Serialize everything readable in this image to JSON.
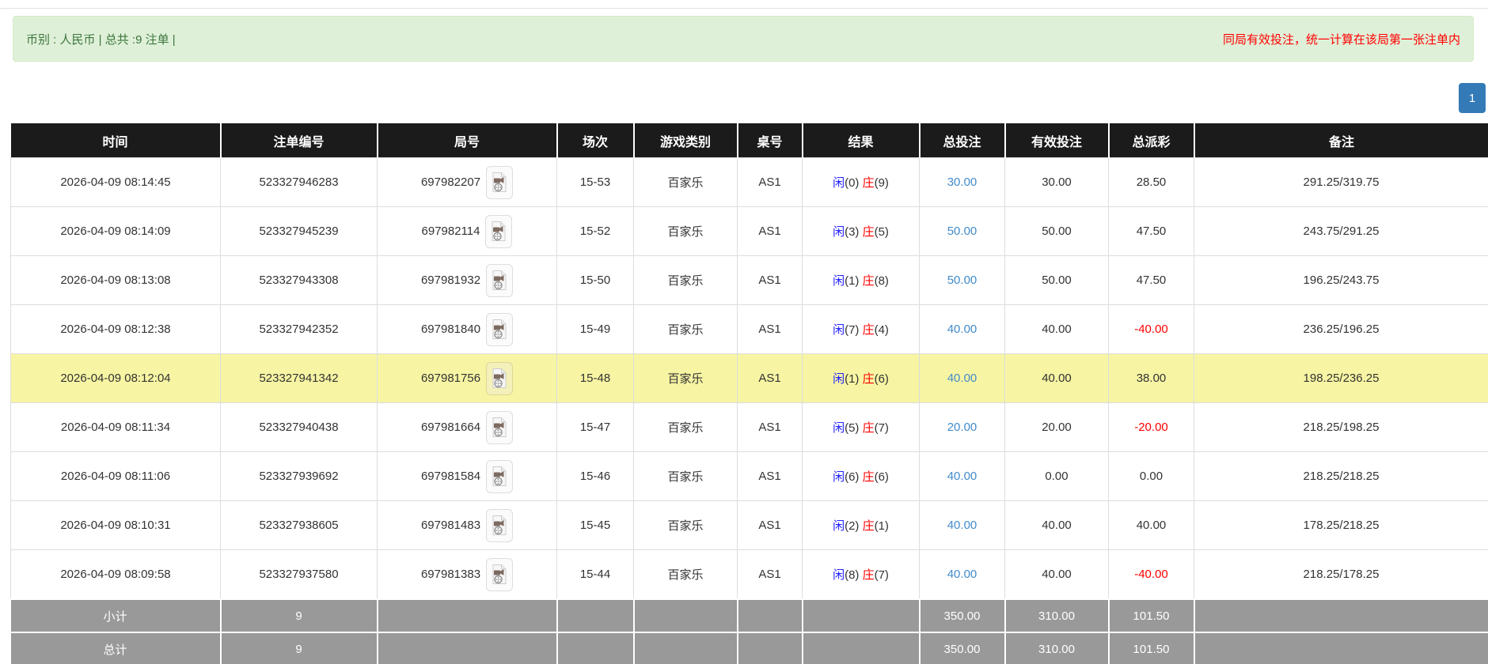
{
  "banner": {
    "left_text": "币别 : 人民币 | 总共 :9 注单 |",
    "right_text": "同局有效投注，统一计算在该局第一张注单内"
  },
  "pagination": {
    "pages": [
      "1"
    ],
    "active_page": "1"
  },
  "table": {
    "columns": [
      {
        "key": "time",
        "label": "时间"
      },
      {
        "key": "bet-no",
        "label": "注单编号"
      },
      {
        "key": "round-no",
        "label": "局号"
      },
      {
        "key": "session",
        "label": "场次"
      },
      {
        "key": "game-type",
        "label": "游戏类别"
      },
      {
        "key": "table-no",
        "label": "桌号"
      },
      {
        "key": "result",
        "label": "结果"
      },
      {
        "key": "total-bet",
        "label": "总投注"
      },
      {
        "key": "valid-bet",
        "label": "有效投注"
      },
      {
        "key": "payout",
        "label": "总派彩"
      },
      {
        "key": "remark",
        "label": "备注"
      }
    ],
    "round_icon": "video-replay-icon",
    "rows": [
      {
        "time": "2026-04-09 08:14:45",
        "bet_no": "523327946283",
        "round_no": "697982207",
        "session": "15-53",
        "game": "百家乐",
        "table_no": "AS1",
        "player": "闲",
        "player_pts": "(0)",
        "banker": "庄",
        "banker_pts": "(9)",
        "total_bet": "30.00",
        "valid_bet": "30.00",
        "payout": "28.50",
        "remark": "291.25/319.75",
        "highlight": false
      },
      {
        "time": "2026-04-09 08:14:09",
        "bet_no": "523327945239",
        "round_no": "697982114",
        "session": "15-52",
        "game": "百家乐",
        "table_no": "AS1",
        "player": "闲",
        "player_pts": "(3)",
        "banker": "庄",
        "banker_pts": "(5)",
        "total_bet": "50.00",
        "valid_bet": "50.00",
        "payout": "47.50",
        "remark": "243.75/291.25",
        "highlight": false
      },
      {
        "time": "2026-04-09 08:13:08",
        "bet_no": "523327943308",
        "round_no": "697981932",
        "session": "15-50",
        "game": "百家乐",
        "table_no": "AS1",
        "player": "闲",
        "player_pts": "(1)",
        "banker": "庄",
        "banker_pts": "(8)",
        "total_bet": "50.00",
        "valid_bet": "50.00",
        "payout": "47.50",
        "remark": "196.25/243.75",
        "highlight": false
      },
      {
        "time": "2026-04-09 08:12:38",
        "bet_no": "523327942352",
        "round_no": "697981840",
        "session": "15-49",
        "game": "百家乐",
        "table_no": "AS1",
        "player": "闲",
        "player_pts": "(7)",
        "banker": "庄",
        "banker_pts": "(4)",
        "total_bet": "40.00",
        "valid_bet": "40.00",
        "payout": "-40.00",
        "remark": "236.25/196.25",
        "highlight": false
      },
      {
        "time": "2026-04-09 08:12:04",
        "bet_no": "523327941342",
        "round_no": "697981756",
        "session": "15-48",
        "game": "百家乐",
        "table_no": "AS1",
        "player": "闲",
        "player_pts": "(1)",
        "banker": "庄",
        "banker_pts": "(6)",
        "total_bet": "40.00",
        "valid_bet": "40.00",
        "payout": "38.00",
        "remark": "198.25/236.25",
        "highlight": true
      },
      {
        "time": "2026-04-09 08:11:34",
        "bet_no": "523327940438",
        "round_no": "697981664",
        "session": "15-47",
        "game": "百家乐",
        "table_no": "AS1",
        "player": "闲",
        "player_pts": "(5)",
        "banker": "庄",
        "banker_pts": "(7)",
        "total_bet": "20.00",
        "valid_bet": "20.00",
        "payout": "-20.00",
        "remark": "218.25/198.25",
        "highlight": false
      },
      {
        "time": "2026-04-09 08:11:06",
        "bet_no": "523327939692",
        "round_no": "697981584",
        "session": "15-46",
        "game": "百家乐",
        "table_no": "AS1",
        "player": "闲",
        "player_pts": "(6)",
        "banker": "庄",
        "banker_pts": "(6)",
        "total_bet": "40.00",
        "valid_bet": "0.00",
        "payout": "0.00",
        "remark": "218.25/218.25",
        "highlight": false
      },
      {
        "time": "2026-04-09 08:10:31",
        "bet_no": "523327938605",
        "round_no": "697981483",
        "session": "15-45",
        "game": "百家乐",
        "table_no": "AS1",
        "player": "闲",
        "player_pts": "(2)",
        "banker": "庄",
        "banker_pts": "(1)",
        "total_bet": "40.00",
        "valid_bet": "40.00",
        "payout": "40.00",
        "remark": "178.25/218.25",
        "highlight": false
      },
      {
        "time": "2026-04-09 08:09:58",
        "bet_no": "523327937580",
        "round_no": "697981383",
        "session": "15-44",
        "game": "百家乐",
        "table_no": "AS1",
        "player": "闲",
        "player_pts": "(8)",
        "banker": "庄",
        "banker_pts": "(7)",
        "total_bet": "40.00",
        "valid_bet": "40.00",
        "payout": "-40.00",
        "remark": "218.25/178.25",
        "highlight": false
      }
    ],
    "subtotal": {
      "label": "小计",
      "bet_count": "9",
      "total_bet": "350.00",
      "valid_bet": "310.00",
      "payout": "101.50"
    },
    "grand_total": {
      "label": "总计",
      "bet_count": "9",
      "total_bet": "350.00",
      "valid_bet": "310.00",
      "payout": "101.50"
    }
  },
  "colors": {
    "accent": "#337ab7",
    "header_bg": "#1b1b1b",
    "banner_bg": "#dff0d8",
    "banner_border": "#d6e9c6",
    "banner_text": "#3c763d",
    "banner_warn": "#ff0000",
    "link": "#428bca",
    "player": "#2222ff",
    "banker": "#ff0000",
    "neg": "#ff0000",
    "row_hl": "#f7f5a3",
    "sum_bg": "#999999"
  }
}
